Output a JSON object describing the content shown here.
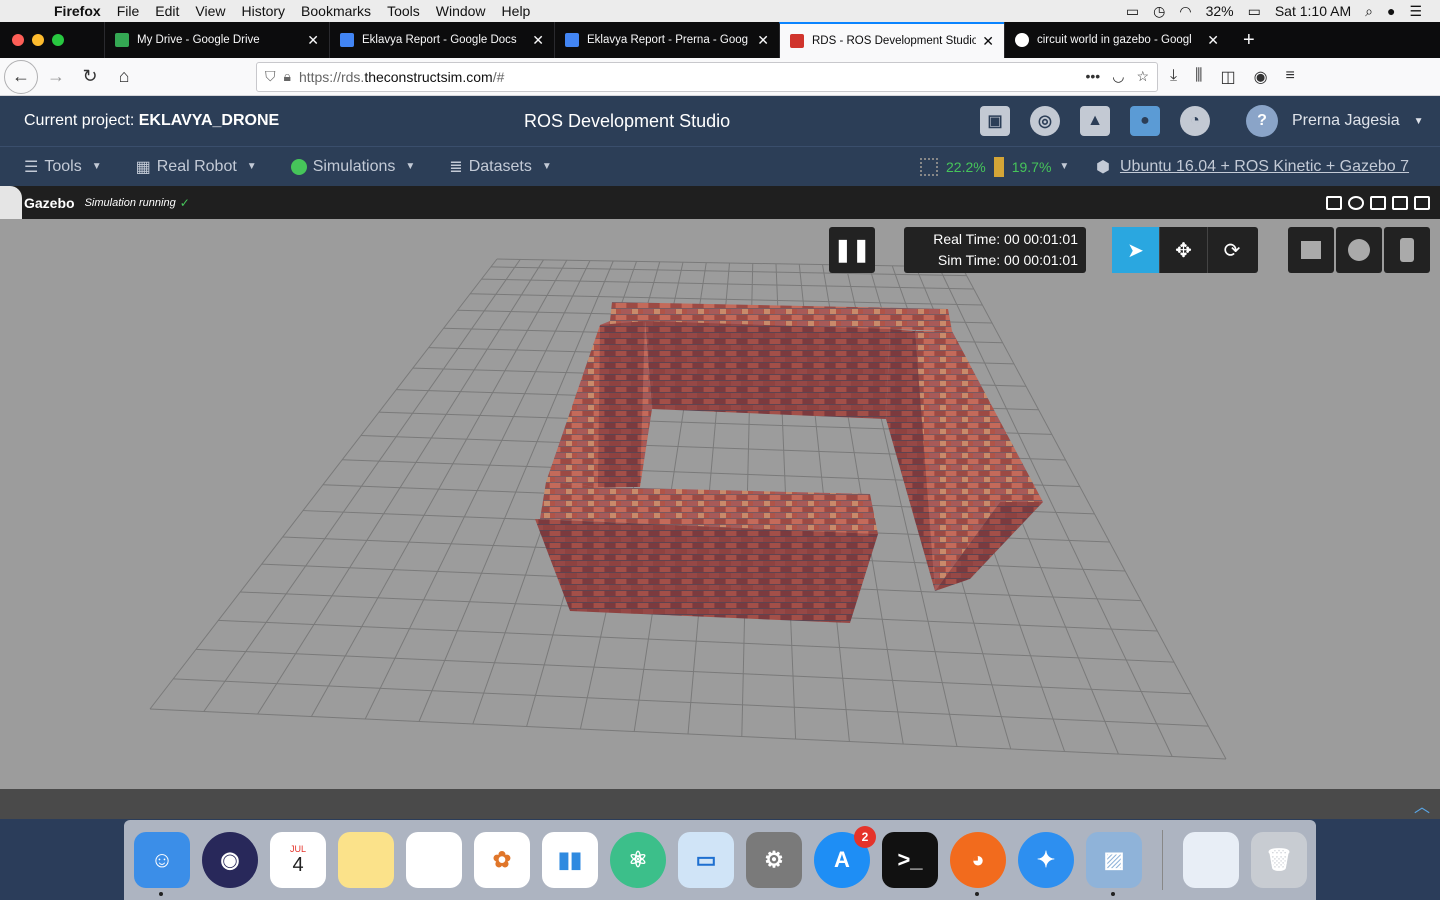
{
  "menubar": {
    "app": "Firefox",
    "items": [
      "File",
      "Edit",
      "View",
      "History",
      "Bookmarks",
      "Tools",
      "Window",
      "Help"
    ],
    "battery": "32%",
    "clock": "Sat 1:10 AM"
  },
  "tabs": [
    {
      "label": "My Drive - Google Drive",
      "fav_color": "#34a853"
    },
    {
      "label": "Eklavya Report - Google Docs",
      "fav_color": "#4285f4"
    },
    {
      "label": "Eklavya Report - Prerna - Goog",
      "fav_color": "#4285f4"
    },
    {
      "label": "RDS - ROS Development Studio",
      "fav_color": "#d0342c"
    },
    {
      "label": "circuit world in gazebo - Googl",
      "fav_color": "#ffffff"
    }
  ],
  "url": {
    "prefix": "https://rds.",
    "host": "theconstructsim.com",
    "suffix": "/#"
  },
  "rds": {
    "project_label": "Current project:",
    "project_name": "EKLAVYA_DRONE",
    "title": "ROS Development Studio",
    "user": "Prerna Jagesia",
    "menu": [
      "Tools",
      "Real Robot",
      "Simulations",
      "Datasets"
    ],
    "cpu": "22.2%",
    "mem": "19.7%",
    "env": "Ubuntu 16.04 + ROS Kinetic + Gazebo 7"
  },
  "gazebo": {
    "name": "Gazebo",
    "status": "Simulation running",
    "real_time": "Real Time: 00 00:01:01",
    "sim_time": "Sim Time: 00 00:01:01"
  },
  "dock": {
    "calendar_month": "JUL",
    "calendar_day": "4",
    "appstore_badge": "2"
  },
  "colors": {
    "accent": "#2aa7e0",
    "header": "#2c3e57",
    "ok": "#46c55a"
  }
}
